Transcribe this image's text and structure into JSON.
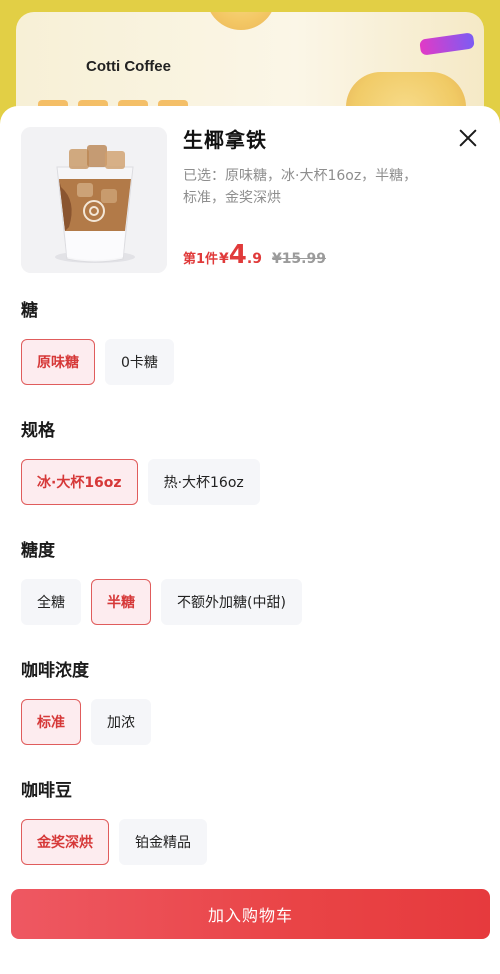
{
  "background": {
    "brand": "Cotti Coffee"
  },
  "product": {
    "name": "生椰拿铁",
    "selected_label": "已选：原味糖，冰·大杯16oz，半糖，标准，金奖深烘",
    "price_prefix": "第1件",
    "price_currency": "¥",
    "price_int": "4",
    "price_dec": ".9",
    "original_price": "¥15.99"
  },
  "options": [
    {
      "title": "糖",
      "items": [
        {
          "label": "原味糖",
          "selected": true
        },
        {
          "label": "0卡糖",
          "selected": false
        }
      ]
    },
    {
      "title": "规格",
      "items": [
        {
          "label": "冰·大杯16oz",
          "selected": true
        },
        {
          "label": "热·大杯16oz",
          "selected": false
        }
      ]
    },
    {
      "title": "糖度",
      "items": [
        {
          "label": "全糖",
          "selected": false
        },
        {
          "label": "半糖",
          "selected": true
        },
        {
          "label": "不额外加糖(中甜)",
          "selected": false
        }
      ]
    },
    {
      "title": "咖啡浓度",
      "items": [
        {
          "label": "标准",
          "selected": true
        },
        {
          "label": "加浓",
          "selected": false
        }
      ]
    },
    {
      "title": "咖啡豆",
      "items": [
        {
          "label": "金奖深烘",
          "selected": true
        },
        {
          "label": "铂金精品",
          "selected": false
        }
      ]
    }
  ],
  "add_to_cart_label": "加入购物车",
  "icons": {
    "close": "close-icon"
  },
  "colors": {
    "accent": "#e03a3a",
    "selected_bg": "#fdecef",
    "option_bg": "#f5f6f9",
    "banner": "#E2CF45"
  }
}
